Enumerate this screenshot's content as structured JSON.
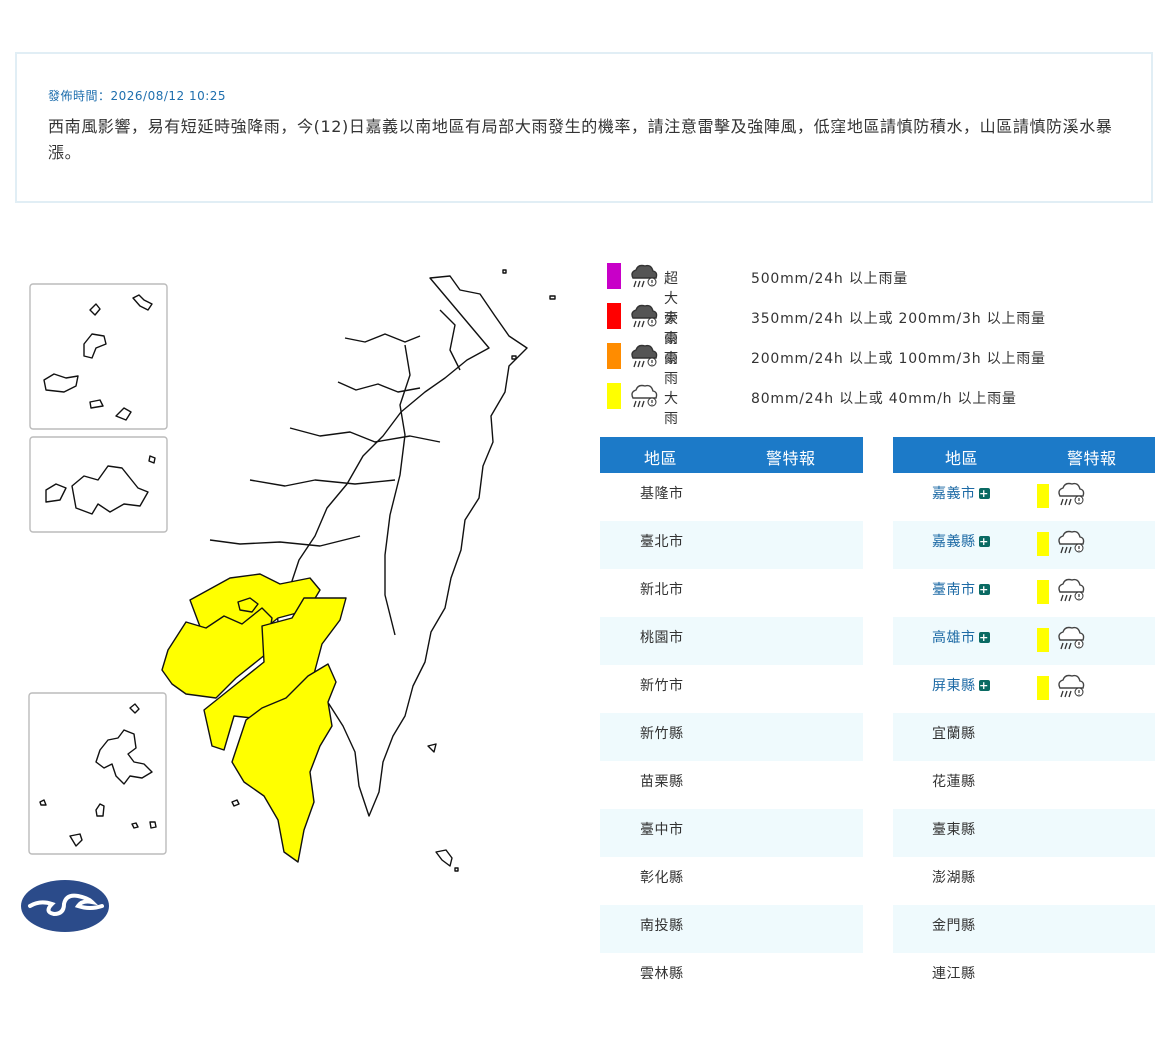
{
  "notice": {
    "time": "發佈時間：2026/08/12 10:25",
    "message": "西南風影響，易有短延時強降雨，今(12)日嘉義以南地區有局部大雨發生的機率，請注意雷擊及強陣風，低窪地區請慎防積水，山區請慎防溪水暴漲。"
  },
  "legend": [
    {
      "name": "超大豪雨",
      "desc": "500mm/24h 以上雨量",
      "color": "#c800c8",
      "icon": "extremely-torrential-rain-icon"
    },
    {
      "name": "大豪雨",
      "desc": "350mm/24h 以上或 200mm/3h 以上雨量",
      "color": "#ff0000",
      "icon": "torrential-rain-icon"
    },
    {
      "name": "豪雨",
      "desc": "200mm/24h 以上或 100mm/3h 以上雨量",
      "color": "#ff8c00",
      "icon": "extremely-heavy-rain-icon"
    },
    {
      "name": "大雨",
      "desc": "80mm/24h 以上或 40mm/h 以上雨量",
      "color": "#ffff00",
      "icon": "heavy-rain-icon"
    }
  ],
  "table": {
    "col_area": "地區",
    "col_warning": "警特報",
    "left": [
      {
        "area": "基隆市"
      },
      {
        "area": "臺北市"
      },
      {
        "area": "新北市"
      },
      {
        "area": "桃園市"
      },
      {
        "area": "新竹市"
      },
      {
        "area": "新竹縣"
      },
      {
        "area": "苗栗縣"
      },
      {
        "area": "臺中市"
      },
      {
        "area": "彰化縣"
      },
      {
        "area": "南投縣"
      },
      {
        "area": "雲林縣"
      }
    ],
    "right": [
      {
        "area": "嘉義市",
        "warning": "大雨"
      },
      {
        "area": "嘉義縣",
        "warning": "大雨"
      },
      {
        "area": "臺南市",
        "warning": "大雨"
      },
      {
        "area": "高雄市",
        "warning": "大雨"
      },
      {
        "area": "屏東縣",
        "warning": "大雨"
      },
      {
        "area": "宜蘭縣"
      },
      {
        "area": "花蓮縣"
      },
      {
        "area": "臺東縣"
      },
      {
        "area": "澎湖縣"
      },
      {
        "area": "金門縣"
      },
      {
        "area": "連江縣"
      }
    ]
  },
  "colors": {
    "warning_yellow": "#ffff00",
    "header_blue": "#1c7ac8",
    "map_fill": "#ffffff",
    "map_stroke": "#111111"
  },
  "logo": "cwa-logo"
}
